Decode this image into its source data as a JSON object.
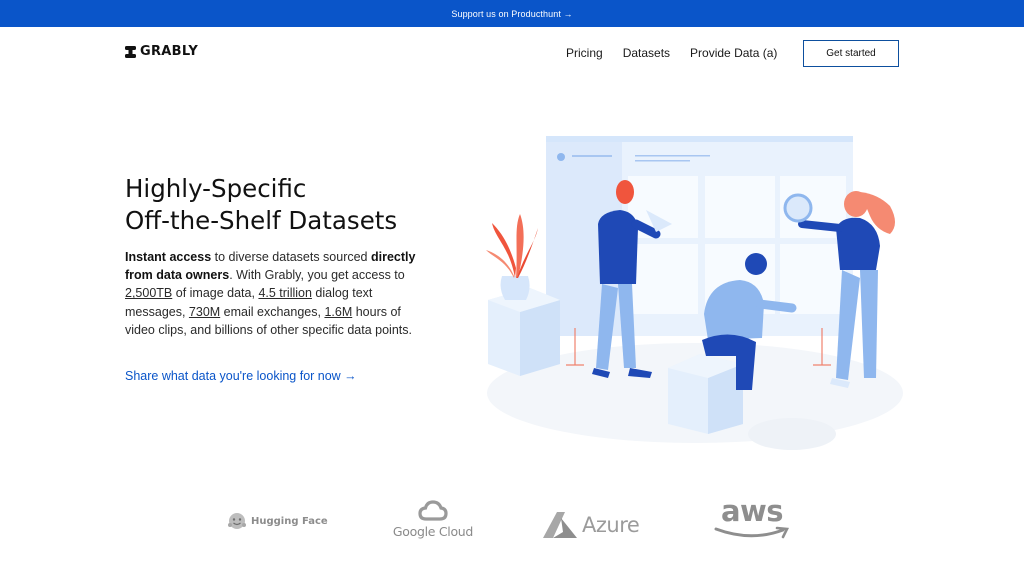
{
  "announcement": {
    "text": "Support us on Producthunt →"
  },
  "header": {
    "logo_text": "GRABLY",
    "nav": [
      {
        "label": "Pricing"
      },
      {
        "label": "Datasets"
      },
      {
        "label": "Provide Data (a)"
      }
    ],
    "cta_label": "Get started"
  },
  "hero": {
    "title_line1": "Highly-Specific",
    "title_line2": "Off-the-Shelf Datasets",
    "body": {
      "p1_bold": "Instant access",
      "p2": " to diverse datasets sourced ",
      "p3_bold": "directly from data owners",
      "p4": ". With Grably, you get access to ",
      "stat1": "2,500TB",
      "p5": " of image data, ",
      "stat2": "4.5 trillion",
      "p6": " dialog text messages, ",
      "stat3": "730M",
      "p7": " email exchanges, ",
      "stat4": "1.6M",
      "p8": " hours of video clips, and billions of other specific data points."
    },
    "link_label": "Share what data you're looking for now →"
  },
  "partners": {
    "huggingface": "Hugging Face",
    "googlecloud": "Google Cloud",
    "azure": "Azure",
    "aws": "aws"
  },
  "colors": {
    "brand_blue": "#0a55c9",
    "cta_border": "#0d4f9e",
    "illustration_blue": "#1f49b6",
    "illustration_light": "#e8f1fd",
    "illustration_accent": "#f0553d"
  }
}
